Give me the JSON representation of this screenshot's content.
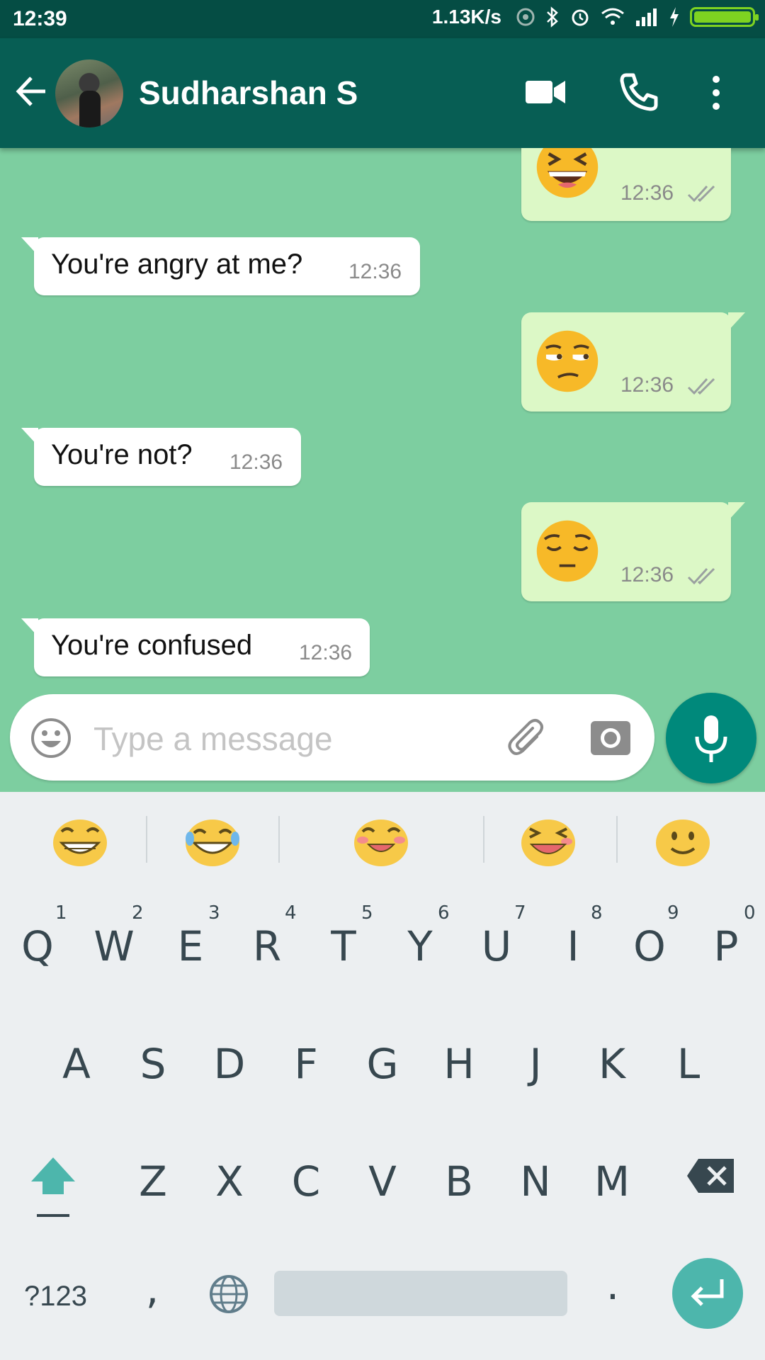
{
  "status_bar": {
    "time": "12:39",
    "network_speed": "1.13K/s"
  },
  "header": {
    "contact_name": "Sudharshan S"
  },
  "messages": [
    {
      "direction": "out",
      "type": "emoji",
      "emoji": "grinning-squinting-face",
      "time": "12:36"
    },
    {
      "direction": "in",
      "type": "text",
      "text": "You're angry at me?",
      "time": "12:36"
    },
    {
      "direction": "out",
      "type": "emoji",
      "emoji": "unamused-face",
      "time": "12:36"
    },
    {
      "direction": "in",
      "type": "text",
      "text": "You're not?",
      "time": "12:36"
    },
    {
      "direction": "out",
      "type": "emoji",
      "emoji": "pensive-face",
      "time": "12:36"
    },
    {
      "direction": "in",
      "type": "text",
      "text": "You're confused",
      "time": "12:36"
    }
  ],
  "composer": {
    "placeholder": "Type a message"
  },
  "keyboard": {
    "suggestions": [
      "beaming-face",
      "tears-of-joy-face",
      "smiling-blush-face",
      "laughing-squint-face",
      "slightly-smiling-face"
    ],
    "row1": [
      "Q",
      "W",
      "E",
      "R",
      "T",
      "Y",
      "U",
      "I",
      "O",
      "P"
    ],
    "row1_hints": [
      "1",
      "2",
      "3",
      "4",
      "5",
      "6",
      "7",
      "8",
      "9",
      "0"
    ],
    "row2": [
      "A",
      "S",
      "D",
      "F",
      "G",
      "H",
      "J",
      "K",
      "L"
    ],
    "row3": [
      "Z",
      "X",
      "C",
      "V",
      "B",
      "N",
      "M"
    ],
    "symbols_label": "?123",
    "comma": ",",
    "period": "."
  },
  "colors": {
    "header": "#075e54",
    "status_bar": "#054d44",
    "chat_background": "#7dcea0",
    "outgoing_bubble": "#dcf8c6",
    "incoming_bubble": "#ffffff",
    "mic_button": "#00897b",
    "enter_key": "#4db6ac"
  }
}
